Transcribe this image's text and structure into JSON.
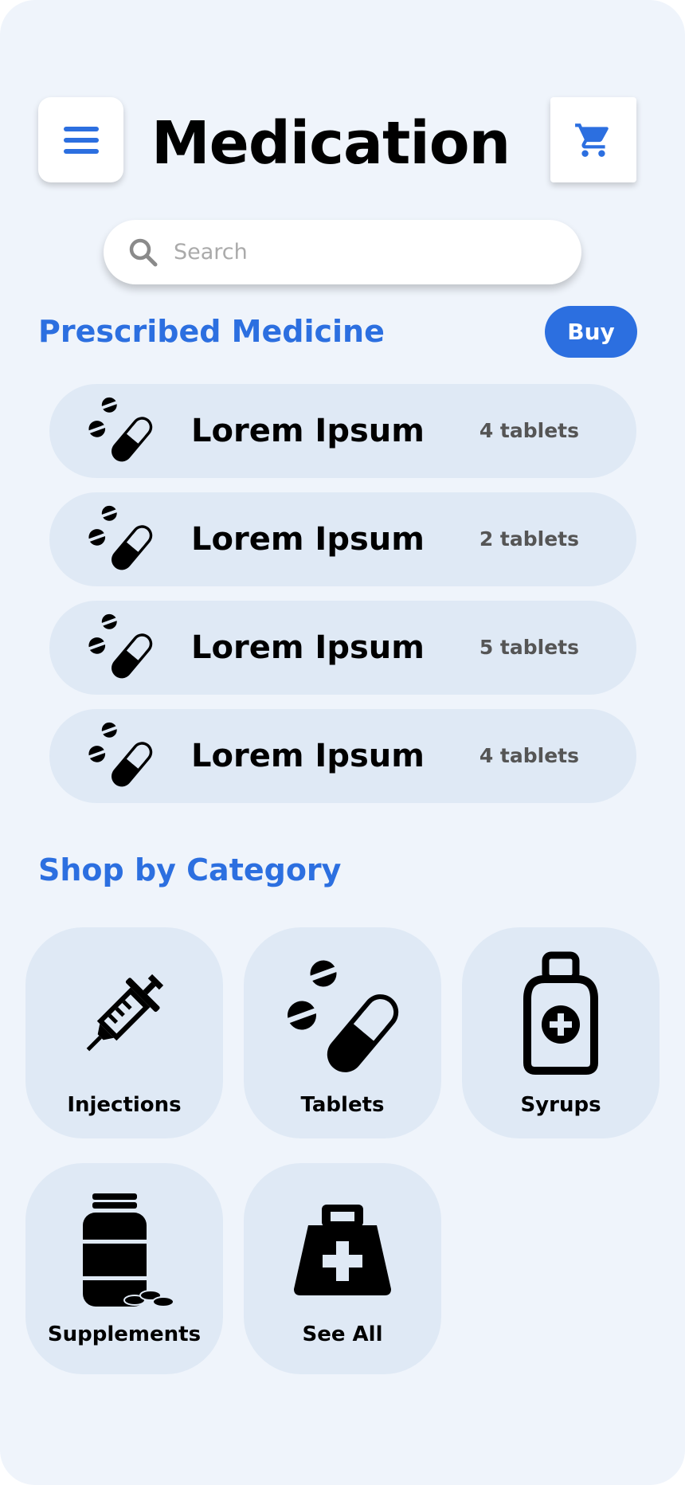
{
  "header": {
    "title": "Medication",
    "menu_icon": "hamburger-menu-icon",
    "cart_icon": "shopping-cart-icon"
  },
  "search": {
    "placeholder": "Search",
    "value": ""
  },
  "prescribed": {
    "title": "Prescribed Medicine",
    "buy_label": "Buy",
    "items": [
      {
        "name": "Lorem Ipsum",
        "qty": "4 tablets",
        "icon": "pills-icon"
      },
      {
        "name": "Lorem Ipsum",
        "qty": "2 tablets",
        "icon": "pills-icon"
      },
      {
        "name": "Lorem Ipsum",
        "qty": "5 tablets",
        "icon": "pills-icon"
      },
      {
        "name": "Lorem Ipsum",
        "qty": "4 tablets",
        "icon": "pills-icon"
      }
    ]
  },
  "categories": {
    "title": "Shop by Category",
    "items": [
      {
        "label": "Injections",
        "icon": "syringe-icon"
      },
      {
        "label": "Tablets",
        "icon": "pills-icon"
      },
      {
        "label": "Syrups",
        "icon": "syrup-bottle-icon"
      },
      {
        "label": "Supplements",
        "icon": "supplement-jar-icon"
      },
      {
        "label": "See All",
        "icon": "medical-bag-icon"
      }
    ]
  },
  "colors": {
    "accent": "#2c6fe0",
    "background": "#eff4fb",
    "tile": "#dfe9f5"
  }
}
